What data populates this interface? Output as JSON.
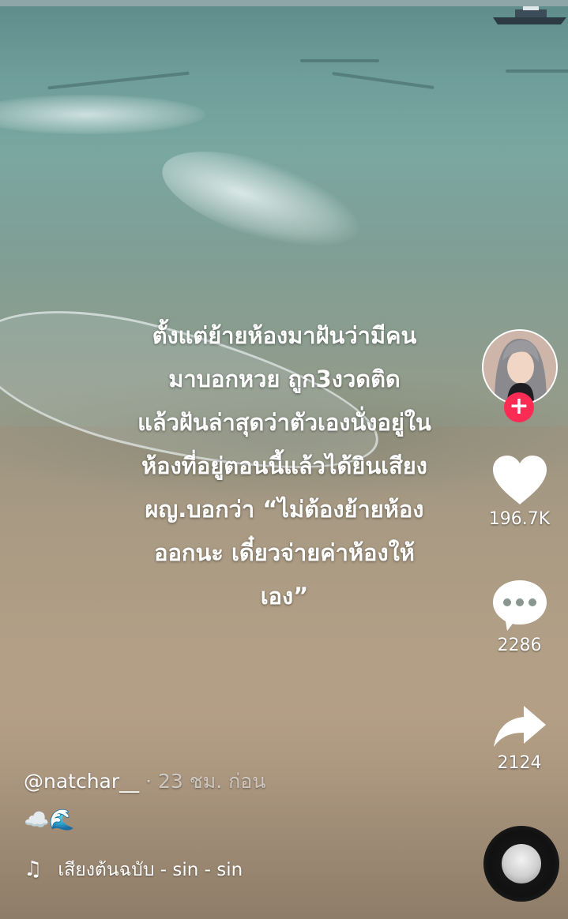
{
  "video": {
    "caption_lines": [
      "ตั้งแต่ย้ายห้องมาฝันว่ามีคน",
      "มาบอกหวย ถูก3งวดติด",
      "แล้วฝันล่าสุดว่าตัวเองนั่งอยู่ใน",
      "ห้องที่อยู่ตอนนี้แล้วได้ยินเสียง",
      "ผญ.บอกว่า “ไม่ต้องย้ายห้อง",
      "ออกนะ เดี๋ยวจ่ายค่าห้องให้",
      "เอง”"
    ]
  },
  "author": {
    "username": "@natchar__",
    "separator": "·",
    "posted": "23 ชม. ก่อน",
    "description_emojis": "☁️🌊"
  },
  "actions": {
    "follow_symbol": "+",
    "likes": "196.7K",
    "comments": "2286",
    "shares": "2124"
  },
  "music": {
    "note_symbol": "♫",
    "title": "เสียงต้นฉบับ - sin - sin"
  },
  "colors": {
    "follow_badge": "#fe2c55",
    "icon": "#ffffff"
  },
  "icons": [
    "heart-icon",
    "comment-icon",
    "share-icon",
    "music-note-icon",
    "plus-icon"
  ]
}
